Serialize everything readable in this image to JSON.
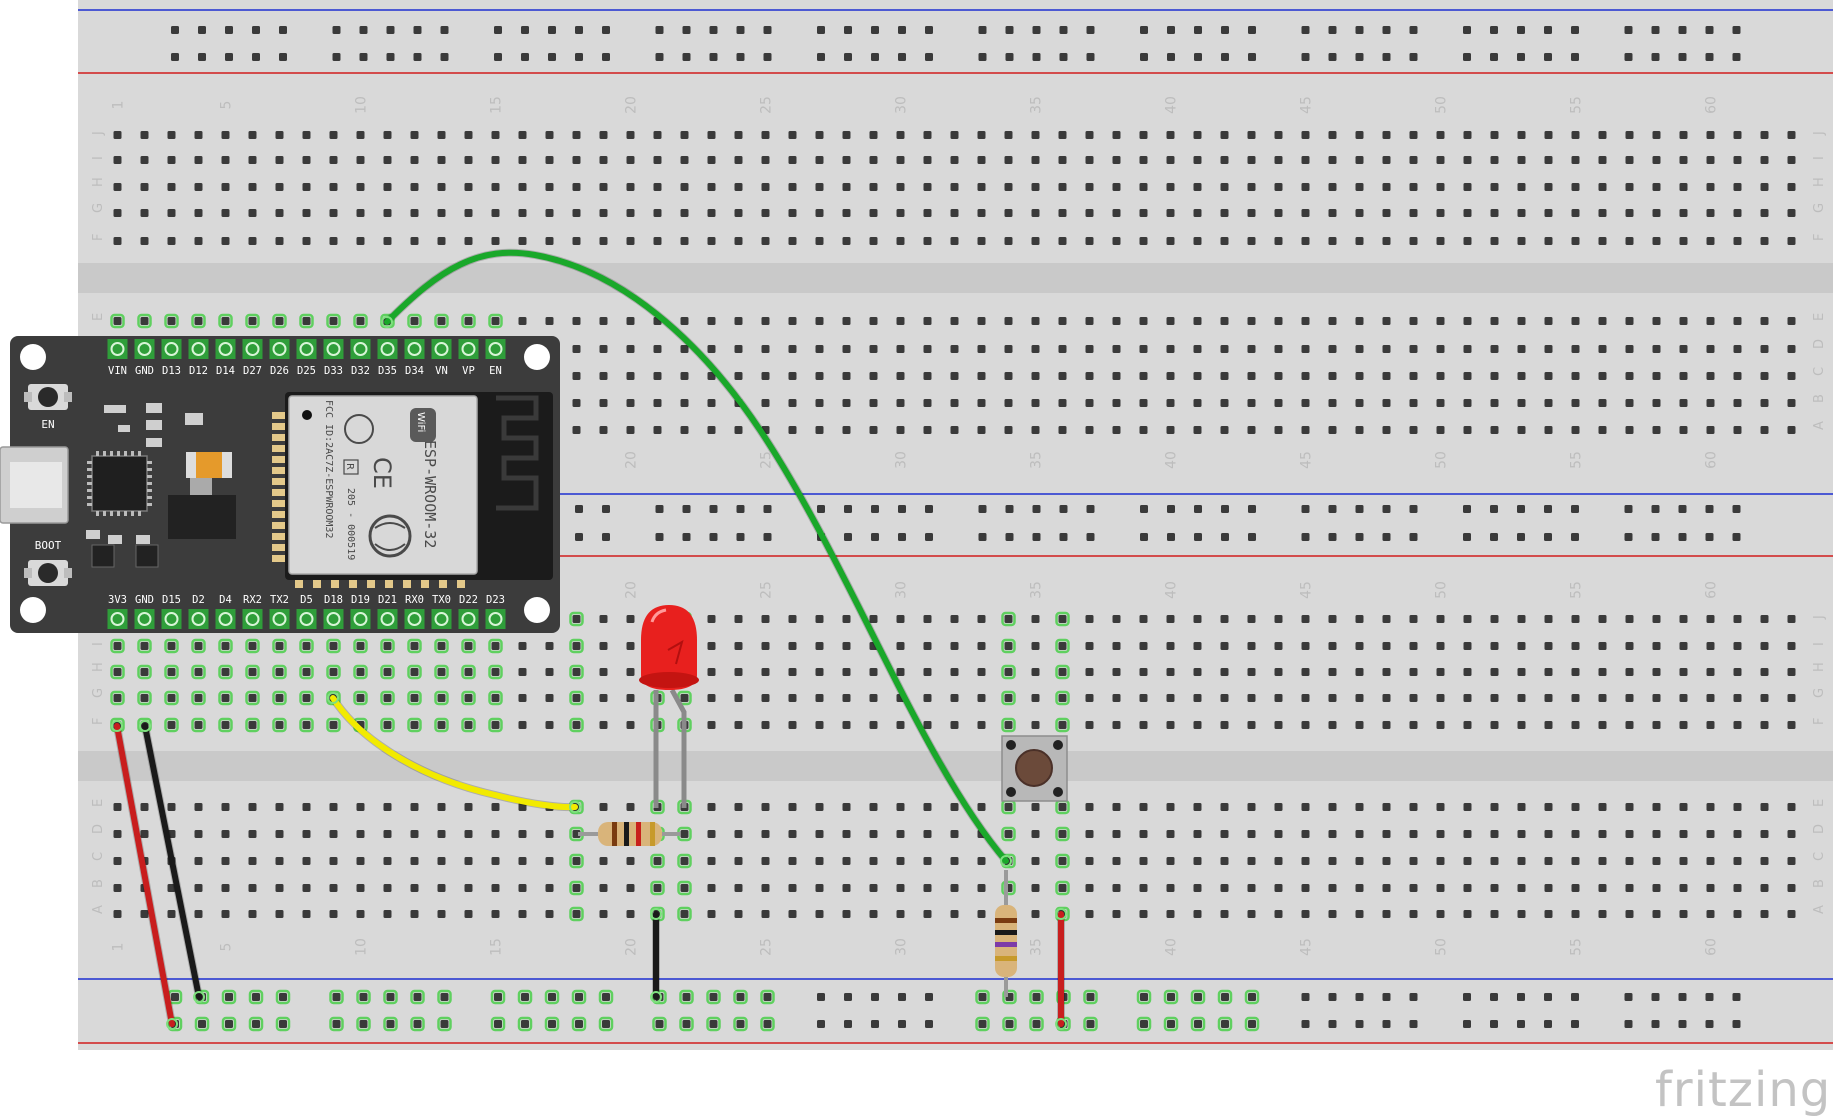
{
  "breadboard": {
    "columns": 63,
    "top_rows": [
      "J",
      "I",
      "H",
      "G",
      "F"
    ],
    "bottom_rows": [
      "E",
      "D",
      "C",
      "B",
      "A"
    ],
    "rows_right": [
      "J",
      "I",
      "H",
      "G",
      "F",
      "E",
      "D",
      "C",
      "B",
      "A"
    ],
    "numbers": [
      "1",
      "5",
      "10",
      "15",
      "20",
      "25",
      "30",
      "35",
      "40",
      "45",
      "50",
      "55",
      "60"
    ]
  },
  "esp32": {
    "top_pins": [
      "VIN",
      "GND",
      "D13",
      "D12",
      "D14",
      "D27",
      "D26",
      "D25",
      "D33",
      "D32",
      "D35",
      "D34",
      "VN",
      "VP",
      "EN"
    ],
    "bottom_pins": [
      "3V3",
      "GND",
      "D15",
      "D2",
      "D4",
      "RX2",
      "TX2",
      "D5",
      "D18",
      "D19",
      "D21",
      "RX0",
      "TX0",
      "D22",
      "D23"
    ],
    "button_en": "EN",
    "button_boot": "BOOT",
    "module_text_model": "ESP-WROOM-32",
    "module_text_fcc": "FCC ID:2AC7Z-ESPWROOM32",
    "module_text_id": "205 - 000519",
    "wifi_logo": "WiFi",
    "ce_mark": "CE",
    "r_mark": "R"
  },
  "wires": [
    {
      "name": "green-signal-wire",
      "color": "#1aa82a"
    },
    {
      "name": "yellow-signal-wire",
      "color": "#f2ea00"
    },
    {
      "name": "red-power-wire-1",
      "color": "#c81e1e"
    },
    {
      "name": "black-ground-wire-1",
      "color": "#1a1a1a"
    },
    {
      "name": "black-ground-wire-2",
      "color": "#1a1a1a"
    },
    {
      "name": "red-power-wire-2",
      "color": "#c81e1e"
    }
  ],
  "components": {
    "led_color": "#e8201e",
    "resistor_body": "#d9b47a",
    "button_cap": "#6b4a3a"
  },
  "brand": {
    "logo_text": "fritzing"
  }
}
